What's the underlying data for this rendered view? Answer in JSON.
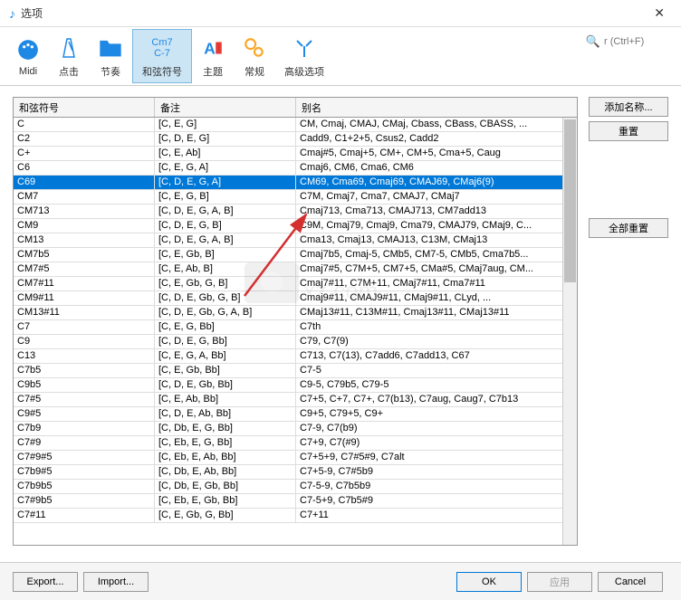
{
  "window": {
    "title": "选项"
  },
  "toolbar": {
    "items": [
      {
        "label": "Midi"
      },
      {
        "label": "点击"
      },
      {
        "label": "节奏"
      },
      {
        "label": "和弦符号",
        "iconText": "Cm7\nC-7"
      },
      {
        "label": "主题"
      },
      {
        "label": "常规"
      },
      {
        "label": "高级选项"
      }
    ],
    "search_placeholder": "r (Ctrl+F)"
  },
  "table": {
    "headers": [
      "和弦符号",
      "备注",
      "别名"
    ],
    "rows": [
      {
        "sym": "C",
        "notes": "[C, E, G]",
        "alias": "CM, Cmaj, CMAJ, CMaj, Cbass, CBass, CBASS, ..."
      },
      {
        "sym": "C2",
        "notes": "[C, D, E, G]",
        "alias": "Cadd9, C1+2+5, Csus2, Cadd2"
      },
      {
        "sym": "C+",
        "notes": "[C, E, Ab]",
        "alias": "Cmaj#5, Cmaj+5, CM+, CM+5, Cma+5, Caug"
      },
      {
        "sym": "C6",
        "notes": "[C, E, G, A]",
        "alias": "Cmaj6, CM6, Cma6, CM6"
      },
      {
        "sym": "C69",
        "notes": "[C, D, E, G, A]",
        "alias": "CM69, Cma69, Cmaj69, CMAJ69, CMaj6(9)",
        "sel": true
      },
      {
        "sym": "CM7",
        "notes": "[C, E, G, B]",
        "alias": "C7M, Cmaj7, Cma7, CMAJ7, CMaj7"
      },
      {
        "sym": "CM713",
        "notes": "[C, D, E, G, A, B]",
        "alias": "Cmaj713, Cma713, CMAJ713, CM7add13"
      },
      {
        "sym": "CM9",
        "notes": "[C, D, E, G, B]",
        "alias": "C9M, Cmaj79, Cmaj9, Cma79, CMAJ79, CMaj9, C..."
      },
      {
        "sym": "CM13",
        "notes": "[C, D, E, G, A, B]",
        "alias": "Cma13, Cmaj13, CMAJ13, C13M, CMaj13"
      },
      {
        "sym": "CM7b5",
        "notes": "[C, E, Gb, B]",
        "alias": "Cmaj7b5, Cmaj-5, CMb5, CM7-5, CMb5, Cma7b5..."
      },
      {
        "sym": "CM7#5",
        "notes": "[C, E, Ab, B]",
        "alias": "Cmaj7#5, C7M+5, CM7+5, CMa#5, CMaj7aug, CM..."
      },
      {
        "sym": "CM7#11",
        "notes": "[C, E, Gb, G, B]",
        "alias": "Cmaj7#11, C7M+11, CMaj7#11, Cma7#11"
      },
      {
        "sym": "CM9#11",
        "notes": "[C, D, E, Gb, G, B]",
        "alias": "Cmaj9#11, CMAJ9#11, CMaj9#11, CLyd, ..."
      },
      {
        "sym": "CM13#11",
        "notes": "[C, D, E, Gb, G, A, B]",
        "alias": "CMaj13#11, C13M#11, Cmaj13#11, CMaj13#11"
      },
      {
        "sym": "C7",
        "notes": "[C, E, G, Bb]",
        "alias": "C7th"
      },
      {
        "sym": "C9",
        "notes": "[C, D, E, G, Bb]",
        "alias": "C79, C7(9)"
      },
      {
        "sym": "C13",
        "notes": "[C, E, G, A, Bb]",
        "alias": "C713, C7(13), C7add6, C7add13, C67"
      },
      {
        "sym": "C7b5",
        "notes": "[C, E, Gb, Bb]",
        "alias": "C7-5"
      },
      {
        "sym": "C9b5",
        "notes": "[C, D, E, Gb, Bb]",
        "alias": "C9-5, C79b5, C79-5"
      },
      {
        "sym": "C7#5",
        "notes": "[C, E, Ab, Bb]",
        "alias": "C7+5, C+7, C7+, C7(b13), C7aug, Caug7, C7b13"
      },
      {
        "sym": "C9#5",
        "notes": "[C, D, E, Ab, Bb]",
        "alias": "C9+5, C79+5, C9+"
      },
      {
        "sym": "C7b9",
        "notes": "[C, Db, E, G, Bb]",
        "alias": "C7-9, C7(b9)"
      },
      {
        "sym": "C7#9",
        "notes": "[C, Eb, E, G, Bb]",
        "alias": "C7+9, C7(#9)"
      },
      {
        "sym": "C7#9#5",
        "notes": "[C, Eb, E, Ab, Bb]",
        "alias": "C7+5+9, C7#5#9, C7alt"
      },
      {
        "sym": "C7b9#5",
        "notes": "[C, Db, E, Ab, Bb]",
        "alias": "C7+5-9, C7#5b9"
      },
      {
        "sym": "C7b9b5",
        "notes": "[C, Db, E, Gb, Bb]",
        "alias": "C7-5-9, C7b5b9"
      },
      {
        "sym": "C7#9b5",
        "notes": "[C, Eb, E, Gb, Bb]",
        "alias": "C7-5+9, C7b5#9"
      },
      {
        "sym": "C7#11",
        "notes": "[C, E, Gb, G, Bb]",
        "alias": "C7+11"
      }
    ]
  },
  "side": {
    "add_name": "添加名称...",
    "reset": "重置",
    "reset_all": "全部重置"
  },
  "bottom": {
    "export": "Export...",
    "import": "Import...",
    "ok": "OK",
    "apply": "应用",
    "cancel": "Cancel"
  }
}
